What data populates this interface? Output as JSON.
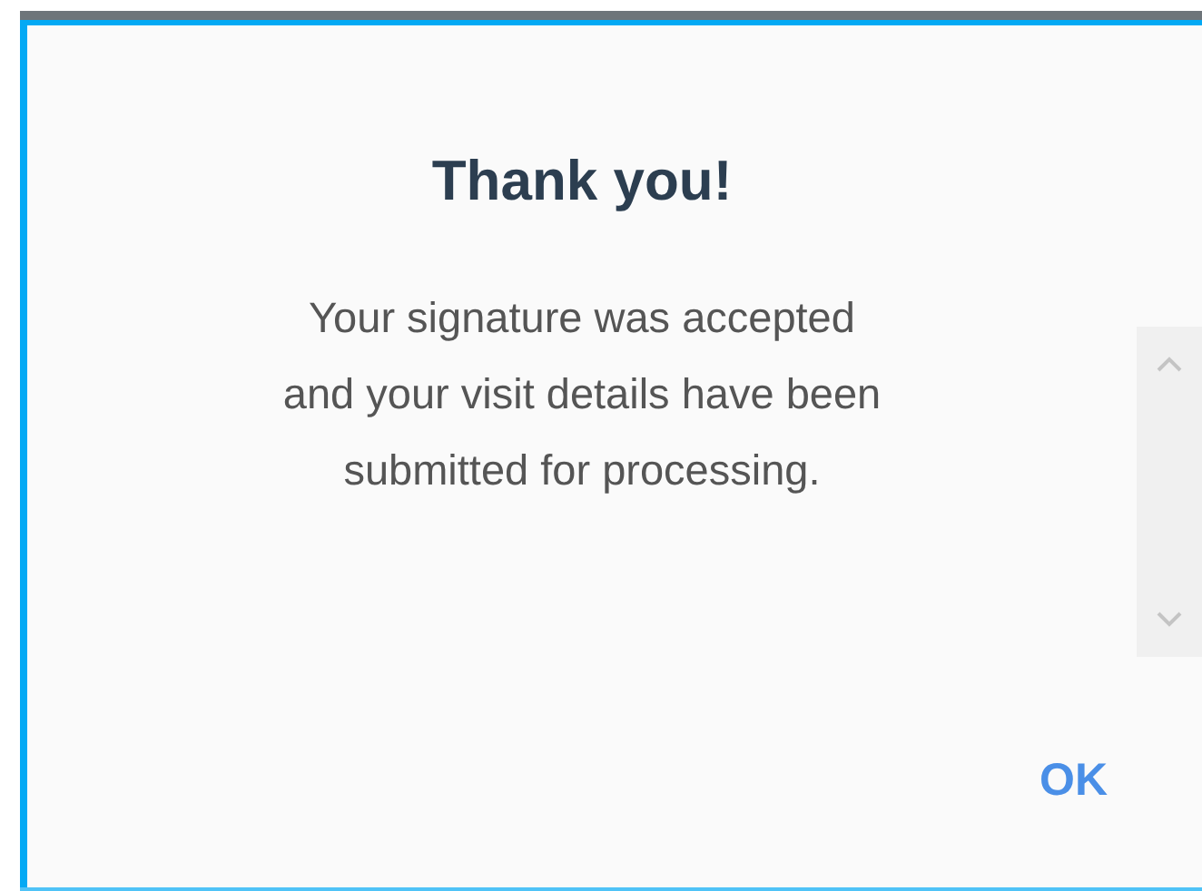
{
  "dialog": {
    "title": "Thank you!",
    "message_lines": [
      "Your signature was accepted",
      "and your visit details have been",
      "submitted for processing."
    ],
    "buttons": [
      "OK"
    ]
  }
}
